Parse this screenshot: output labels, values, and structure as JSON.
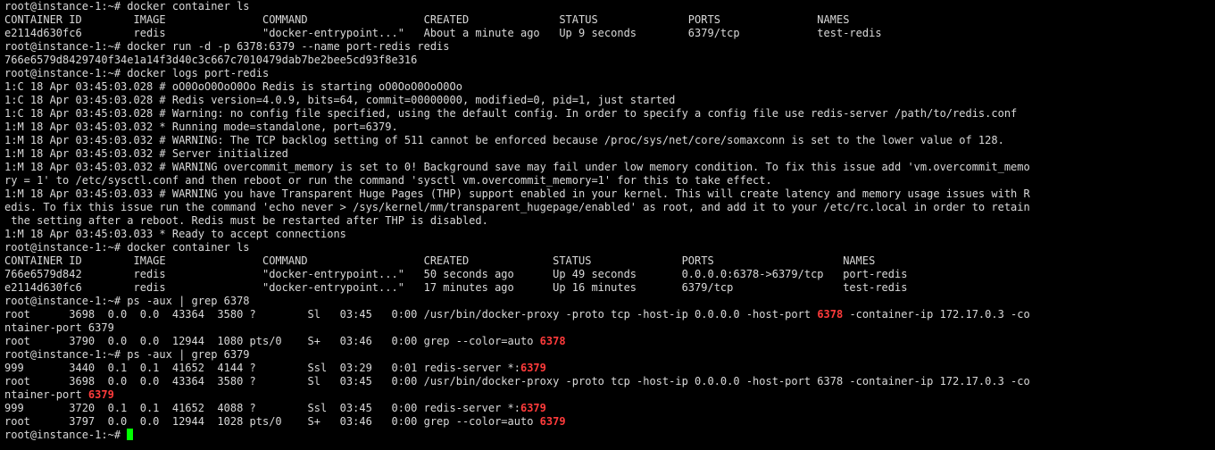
{
  "terminal": {
    "highlight_color": "#ff3b3b",
    "cursor_color": "#00ff00",
    "prompt": "root@instance-1:~# ",
    "lines": [
      [
        {
          "t": "root@instance-1:~# docker container ls"
        }
      ],
      [
        {
          "t": "CONTAINER ID        IMAGE               COMMAND                  CREATED              STATUS              PORTS               NAMES"
        }
      ],
      [
        {
          "t": "e2114d630fc6        redis               \"docker-entrypoint...\"   About a minute ago   Up 9 seconds        6379/tcp            test-redis"
        }
      ],
      [
        {
          "t": "root@instance-1:~# docker run -d -p 6378:6379 --name port-redis redis"
        }
      ],
      [
        {
          "t": "766e6579d8429740f34e1a14f3d40c3c667c7010479dab7be2bee5cd93f8e316"
        }
      ],
      [
        {
          "t": "root@instance-1:~# docker logs port-redis"
        }
      ],
      [
        {
          "t": "1:C 18 Apr 03:45:03.028 # oO0OoO0OoO0Oo Redis is starting oO0OoO0OoO0Oo"
        }
      ],
      [
        {
          "t": "1:C 18 Apr 03:45:03.028 # Redis version=4.0.9, bits=64, commit=00000000, modified=0, pid=1, just started"
        }
      ],
      [
        {
          "t": "1:C 18 Apr 03:45:03.028 # Warning: no config file specified, using the default config. In order to specify a config file use redis-server /path/to/redis.conf"
        }
      ],
      [
        {
          "t": "1:M 18 Apr 03:45:03.032 * Running mode=standalone, port=6379."
        }
      ],
      [
        {
          "t": "1:M 18 Apr 03:45:03.032 # WARNING: The TCP backlog setting of 511 cannot be enforced because /proc/sys/net/core/somaxconn is set to the lower value of 128."
        }
      ],
      [
        {
          "t": "1:M 18 Apr 03:45:03.032 # Server initialized"
        }
      ],
      [
        {
          "t": "1:M 18 Apr 03:45:03.032 # WARNING overcommit_memory is set to 0! Background save may fail under low memory condition. To fix this issue add 'vm.overcommit_memo"
        }
      ],
      [
        {
          "t": "ry = 1' to /etc/sysctl.conf and then reboot or run the command 'sysctl vm.overcommit_memory=1' for this to take effect."
        }
      ],
      [
        {
          "t": "1:M 18 Apr 03:45:03.033 # WARNING you have Transparent Huge Pages (THP) support enabled in your kernel. This will create latency and memory usage issues with R"
        }
      ],
      [
        {
          "t": "edis. To fix this issue run the command 'echo never > /sys/kernel/mm/transparent_hugepage/enabled' as root, and add it to your /etc/rc.local in order to retain"
        }
      ],
      [
        {
          "t": " the setting after a reboot. Redis must be restarted after THP is disabled."
        }
      ],
      [
        {
          "t": "1:M 18 Apr 03:45:03.033 * Ready to accept connections"
        }
      ],
      [
        {
          "t": "root@instance-1:~# docker container ls"
        }
      ],
      [
        {
          "t": "CONTAINER ID        IMAGE               COMMAND                  CREATED             STATUS              PORTS                    NAMES"
        }
      ],
      [
        {
          "t": "766e6579d842        redis               \"docker-entrypoint...\"   50 seconds ago      Up 49 seconds       0.0.0.0:6378->6379/tcp   port-redis"
        }
      ],
      [
        {
          "t": "e2114d630fc6        redis               \"docker-entrypoint...\"   17 minutes ago      Up 16 minutes       6379/tcp                 test-redis"
        }
      ],
      [
        {
          "t": "root@instance-1:~# ps -aux | grep 6378"
        }
      ],
      [
        {
          "t": "root      3698  0.0  0.0  43364  3580 ?        Sl   03:45   0:00 /usr/bin/docker-proxy -proto tcp -host-ip 0.0.0.0 -host-port "
        },
        {
          "t": "6378",
          "hl": true
        },
        {
          "t": " -container-ip 172.17.0.3 -co"
        }
      ],
      [
        {
          "t": "ntainer-port 6379"
        }
      ],
      [
        {
          "t": "root      3790  0.0  0.0  12944  1080 pts/0    S+   03:46   0:00 grep --color=auto "
        },
        {
          "t": "6378",
          "hl": true
        }
      ],
      [
        {
          "t": "root@instance-1:~# ps -aux | grep 6379"
        }
      ],
      [
        {
          "t": "999       3440  0.1  0.1  41652  4144 ?        Ssl  03:29   0:01 redis-server *:"
        },
        {
          "t": "6379",
          "hl": true
        }
      ],
      [
        {
          "t": "root      3698  0.0  0.0  43364  3580 ?        Sl   03:45   0:00 /usr/bin/docker-proxy -proto tcp -host-ip 0.0.0.0 -host-port 6378 -container-ip 172.17.0.3 -co"
        }
      ],
      [
        {
          "t": "ntainer-port "
        },
        {
          "t": "6379",
          "hl": true
        }
      ],
      [
        {
          "t": "999       3720  0.1  0.1  41652  4088 ?        Ssl  03:45   0:00 redis-server *:"
        },
        {
          "t": "6379",
          "hl": true
        }
      ],
      [
        {
          "t": "root      3797  0.0  0.0  12944  1028 pts/0    S+   03:46   0:00 grep --color=auto "
        },
        {
          "t": "6379",
          "hl": true
        }
      ]
    ]
  }
}
